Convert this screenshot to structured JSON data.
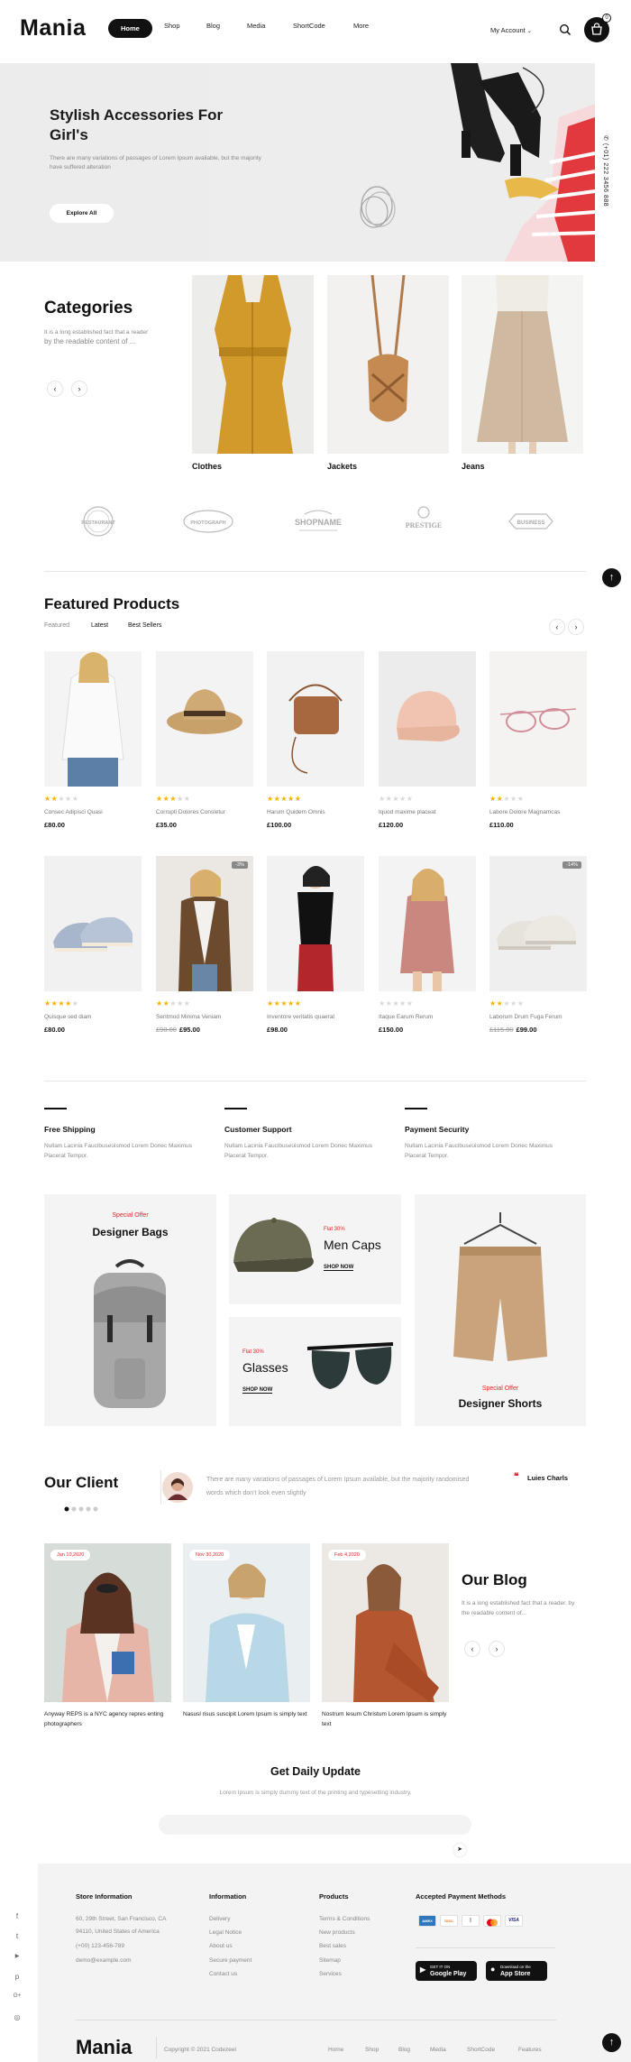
{
  "header": {
    "logo": "Mania",
    "nav": [
      "Home",
      "Shop",
      "Blog",
      "Media",
      "ShortCode",
      "More"
    ],
    "my_account": "My Account",
    "cart_count": "0"
  },
  "hero": {
    "title": "Stylish Accessories For Girl's",
    "text": "There are many variations of passages of Lorem Ipsum available, but the majority have suffered alteration",
    "button": "Explore All",
    "phone": "(+01) 222 3456 888"
  },
  "categories": {
    "title": "Categories",
    "text1": "It is a long established fact that a reader",
    "text2": "by the readable content of ...",
    "items": [
      "Clothes",
      "Jackets",
      "Jeans"
    ]
  },
  "brands": [
    "RESTAURANT",
    "PHOTOGRAPH",
    "SHOPNAME",
    "PRESTIGE",
    "BUSINESS"
  ],
  "featured": {
    "title": "Featured Products",
    "tabs": [
      "Featured",
      "Latest",
      "Best Sellers"
    ],
    "products": [
      {
        "name": "Consec Adipisci Quasi",
        "price": "£80.00",
        "old": "",
        "rating": 2,
        "badge": "",
        "img": "tshirt"
      },
      {
        "name": "Corrupti Dolores Consletur",
        "price": "£35.00",
        "old": "",
        "rating": 3,
        "badge": "",
        "img": "hat"
      },
      {
        "name": "Harum Quidem Omnis",
        "price": "£100.00",
        "old": "",
        "rating": 5,
        "badge": "",
        "img": "bag"
      },
      {
        "name": "Iquod maxime placeat",
        "price": "£120.00",
        "old": "",
        "rating": 0,
        "badge": "",
        "img": "cap"
      },
      {
        "name": "Labore Dolore Magnamcas",
        "price": "£110.00",
        "old": "",
        "rating": 2,
        "badge": "",
        "img": "glasses"
      },
      {
        "name": "Quisque sed diam",
        "price": "£80.00",
        "old": "",
        "rating": 4,
        "badge": "",
        "img": "shoes"
      },
      {
        "name": "Sentmod Minima Veniam",
        "price": "£95.00",
        "old": "£98.00",
        "rating": 2,
        "badge": "-3%",
        "img": "cardigan"
      },
      {
        "name": "Inventore veritatis quaerat",
        "price": "£98.00",
        "old": "",
        "rating": 5,
        "badge": "",
        "img": "redjeans"
      },
      {
        "name": "Itaque Earum Rerum",
        "price": "£150.00",
        "old": "",
        "rating": 0,
        "badge": "",
        "img": "dress"
      },
      {
        "name": "Laborum Drum Fuga Ferum",
        "price": "£99.00",
        "old": "£115.00",
        "rating": 2,
        "badge": "-14%",
        "img": "sneaker"
      }
    ]
  },
  "features": [
    {
      "title": "Free Shipping",
      "text": "Nullam Lacinia Faucibuseuismod Lorem Donec Maximus Placerat Tempor."
    },
    {
      "title": "Customer Support",
      "text": "Nullam Lacinia Faucibuseuismod Lorem Donec Maximus Placerat Tempor."
    },
    {
      "title": "Payment Security",
      "text": "Nullam Lacinia Faucibuseuismod Lorem Donec Maximus Placerat Tempor."
    }
  ],
  "offers": {
    "bags_tag": "Special Offer",
    "bags": "Designer Bags",
    "caps_tag": "Flat 30%",
    "caps": "Men Caps",
    "caps_link": "SHOP NOW",
    "glasses_tag": "Flat 30%",
    "glasses": "Glasses",
    "glasses_link": "SHOP NOW",
    "shorts_tag": "Special Offer",
    "shorts": "Designer Shorts"
  },
  "client": {
    "title": "Our Client",
    "quote": "There are many variations of passages of Lorem Ipsum available, but the majority randomised words which don't look even slightly",
    "name": "Luies Charls"
  },
  "blog": {
    "title": "Our Blog",
    "text": "It is a long established fact that a reader. by the readable content of...",
    "posts": [
      {
        "date": "Jan 10,2020",
        "text": "Anyway REPS is a NYC agency repres enting photographers"
      },
      {
        "date": "Nov 30,2020",
        "text": "Nasusl risus suscipit Lorem Ipsum is simply text"
      },
      {
        "date": "Feb 4,2020",
        "text": "Nostrum Iesum Christum Lorem Ipsum is simply text"
      }
    ]
  },
  "newsletter": {
    "title": "Get Daily Update",
    "text": "Lorem Ipsum is simply dummy text of the printing and typesetting industry."
  },
  "footer": {
    "store_title": "Store Information",
    "address1": "60, 29th Street, San Francisco, CA",
    "address2": "94110, United States of America",
    "phone": "(+00) 123-456-789",
    "email": "demo@example.com",
    "info_title": "Information",
    "info": [
      "Delivery",
      "Legal Notice",
      "About us",
      "Secure payment",
      "Contact us"
    ],
    "products_title": "Products",
    "products": [
      "Terms & Conditions",
      "New products",
      "Best sales",
      "Sitemap",
      "Services"
    ],
    "pay_title": "Accepted Payment Methods",
    "pay": [
      "AMEX",
      "DISC",
      "||",
      "MC",
      "VISA"
    ],
    "gp_small": "GET IT ON",
    "gp": "Google Play",
    "as_small": "Download on the",
    "as": "App Store",
    "logo": "Mania",
    "copyright": "Copyright © 2021 Codezeel",
    "nav": [
      "Home",
      "Shop",
      "Blog",
      "Media",
      "ShortCode",
      "Features"
    ]
  },
  "social": [
    "f",
    "t",
    "▶",
    "p",
    "G+",
    "◎"
  ]
}
